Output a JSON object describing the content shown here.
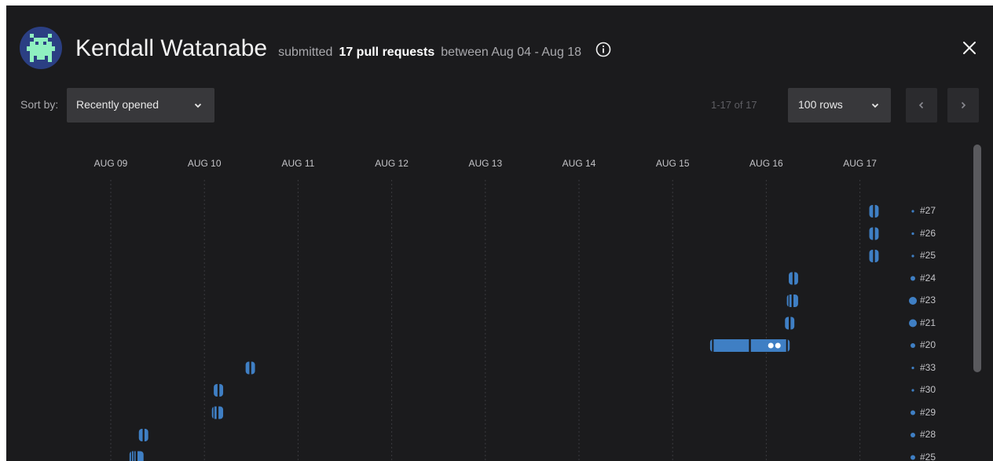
{
  "header": {
    "user_name": "Kendall Watanabe",
    "verb": "submitted",
    "count_text": "17 pull requests",
    "range_text": "between Aug 04 - Aug 18",
    "info_icon": "info-icon",
    "close_icon": "close-icon"
  },
  "toolbar": {
    "sort_label": "Sort by:",
    "sort_value": "Recently opened",
    "pager_text": "1-17 of 17",
    "rows_value": "100 rows",
    "prev_icon": "chevron-left-icon",
    "next_icon": "chevron-right-icon"
  },
  "colors": {
    "background": "#1b1b1d",
    "bar": "#3f7fc4",
    "select": "#38383b"
  },
  "timeline": {
    "dates": [
      "AUG 09",
      "AUG 10",
      "AUG 11",
      "AUG 12",
      "AUG 13",
      "AUG 14",
      "AUG 15",
      "AUG 16",
      "AUG 17"
    ],
    "prs": [
      {
        "label": "#27",
        "day": "AUG 17",
        "start": 17.1,
        "end": 17.2,
        "dot": "small",
        "commits": 0
      },
      {
        "label": "#26",
        "day": "AUG 17",
        "start": 17.1,
        "end": 17.2,
        "dot": "small",
        "commits": 0
      },
      {
        "label": "#25",
        "day": "AUG 17",
        "start": 17.1,
        "end": 17.2,
        "dot": "small",
        "commits": 0
      },
      {
        "label": "#24",
        "day": "AUG 16",
        "start": 16.24,
        "end": 16.34,
        "dot": "medium",
        "commits": 0
      },
      {
        "label": "#23",
        "day": "AUG 16",
        "start": 16.22,
        "end": 16.34,
        "dot": "large",
        "commits": 1
      },
      {
        "label": "#21",
        "day": "AUG 16",
        "start": 16.2,
        "end": 16.3,
        "dot": "large",
        "commits": 0
      },
      {
        "label": "#20",
        "day": "AUG 15",
        "start": 15.4,
        "end": 16.25,
        "dot": "medium",
        "commits": 2
      },
      {
        "label": "#33",
        "day": "AUG 10",
        "start": 10.44,
        "end": 10.54,
        "dot": "small",
        "commits": 0
      },
      {
        "label": "#30",
        "day": "AUG 10",
        "start": 10.1,
        "end": 10.2,
        "dot": "small",
        "commits": 0
      },
      {
        "label": "#29",
        "day": "AUG 10",
        "start": 10.08,
        "end": 10.2,
        "dot": "medium",
        "commits": 1
      },
      {
        "label": "#28",
        "day": "AUG 09",
        "start": 9.3,
        "end": 9.4,
        "dot": "medium",
        "commits": 0
      },
      {
        "label": "#25",
        "day": "AUG 09",
        "start": 9.2,
        "end": 9.35,
        "dot": "medium",
        "commits": 2
      }
    ]
  }
}
